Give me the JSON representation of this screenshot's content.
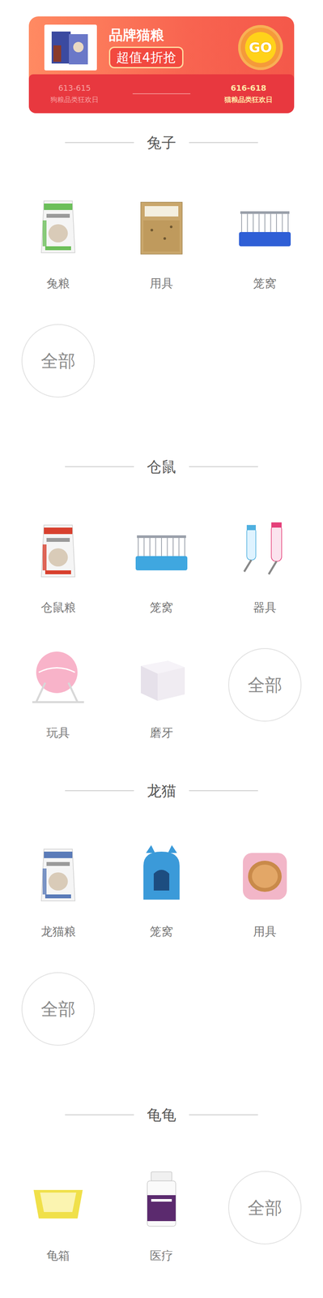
{
  "banner": {
    "title": "品牌猫粮",
    "badge": "超值4折抢",
    "button": "GO",
    "days": [
      {
        "date": "613-615",
        "label": "狗粮品类狂欢日",
        "selected": false
      },
      {
        "date": "616-618",
        "label": "猫粮品类狂欢日",
        "selected": true
      }
    ]
  },
  "sections": [
    {
      "title": "兔子",
      "items": [
        {
          "label": "兔粮",
          "kind": "bag",
          "color": "#6cbf5a"
        },
        {
          "label": "用具",
          "kind": "box",
          "color": "#c9a66b"
        },
        {
          "label": "笼窝",
          "kind": "cage",
          "color": "#2f5fd6"
        },
        {
          "label": "全部",
          "kind": "all",
          "color": "#e2e2e2"
        }
      ]
    },
    {
      "title": "仓鼠",
      "items": [
        {
          "label": "仓鼠粮",
          "kind": "bag",
          "color": "#d8402e"
        },
        {
          "label": "笼窝",
          "kind": "cage",
          "color": "#3fa7e0"
        },
        {
          "label": "器具",
          "kind": "bottle",
          "color": "#e5407a"
        },
        {
          "label": "玩具",
          "kind": "ball",
          "color": "#f7a6bf"
        },
        {
          "label": "磨牙",
          "kind": "block",
          "color": "#e6e1ea"
        },
        {
          "label": "全部",
          "kind": "all",
          "color": "#e2e2e2"
        }
      ]
    },
    {
      "title": "龙猫",
      "items": [
        {
          "label": "龙猫粮",
          "kind": "bag",
          "color": "#5a7bb8"
        },
        {
          "label": "笼窝",
          "kind": "house",
          "color": "#3b9ad9"
        },
        {
          "label": "用具",
          "kind": "nest",
          "color": "#f2b6c8"
        },
        {
          "label": "全部",
          "kind": "all",
          "color": "#e2e2e2"
        }
      ]
    },
    {
      "title": "龟龟",
      "items": [
        {
          "label": "龟箱",
          "kind": "tray",
          "color": "#f0e04a"
        },
        {
          "label": "医疗",
          "kind": "jar",
          "color": "#5b2a6e"
        },
        {
          "label": "全部",
          "kind": "all",
          "color": "#e2e2e2"
        }
      ]
    }
  ]
}
